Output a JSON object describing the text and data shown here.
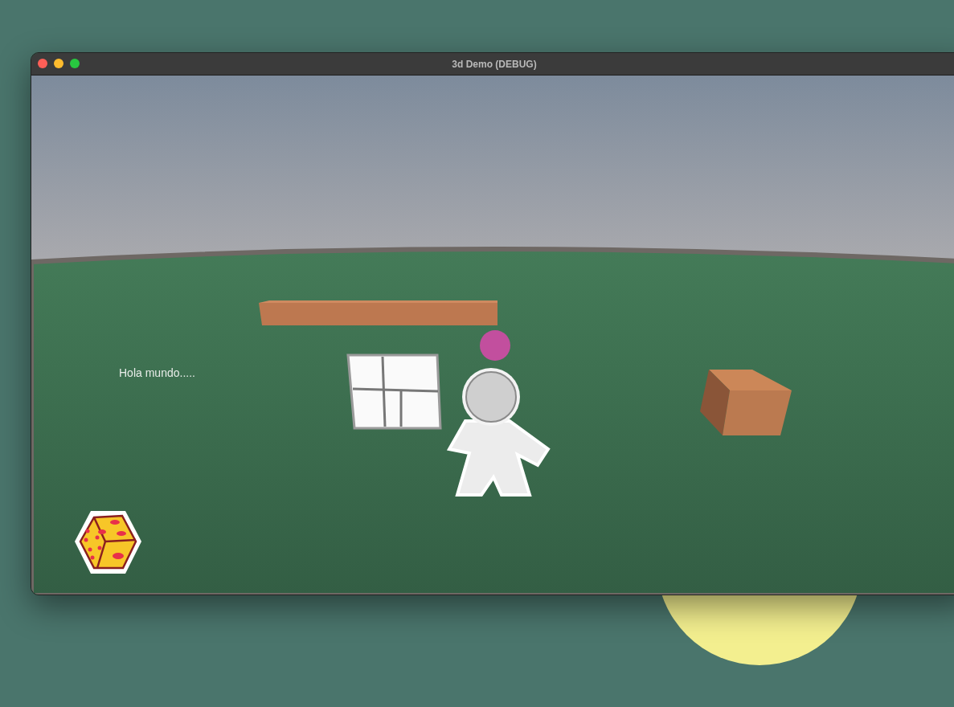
{
  "window": {
    "title": "3d Demo (DEBUG)"
  },
  "scene": {
    "hud_text": "Hola mundo....."
  }
}
